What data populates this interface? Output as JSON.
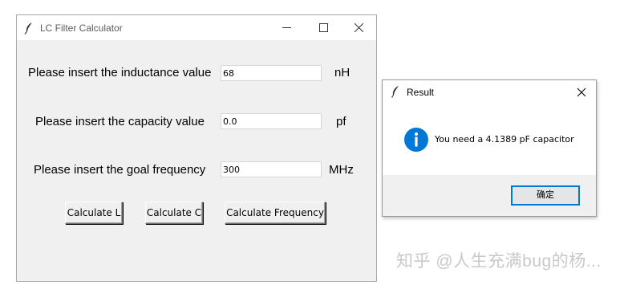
{
  "main_window": {
    "title": "LC Filter Calculator",
    "rows": [
      {
        "label": "Please insert the inductance value",
        "value": "68",
        "unit": "nH"
      },
      {
        "label": "Please insert the capacity value",
        "value": "0.0",
        "unit": "pf"
      },
      {
        "label": "Please insert the goal frequency",
        "value": "300",
        "unit": "MHz"
      }
    ],
    "buttons": {
      "calc_l": "Calculate L",
      "calc_c": "Calculate C",
      "calc_freq": "Calculate Frequency"
    }
  },
  "dialog": {
    "title": "Result",
    "message": "You need a 4.1389 pF capacitor",
    "ok_label": "确定",
    "icon": "info-icon"
  },
  "watermark": "知乎 @人生充满bug的杨...",
  "colors": {
    "window_bg": "#f0f0f0",
    "info_blue": "#0078d7",
    "ok_border": "#0078d7"
  }
}
